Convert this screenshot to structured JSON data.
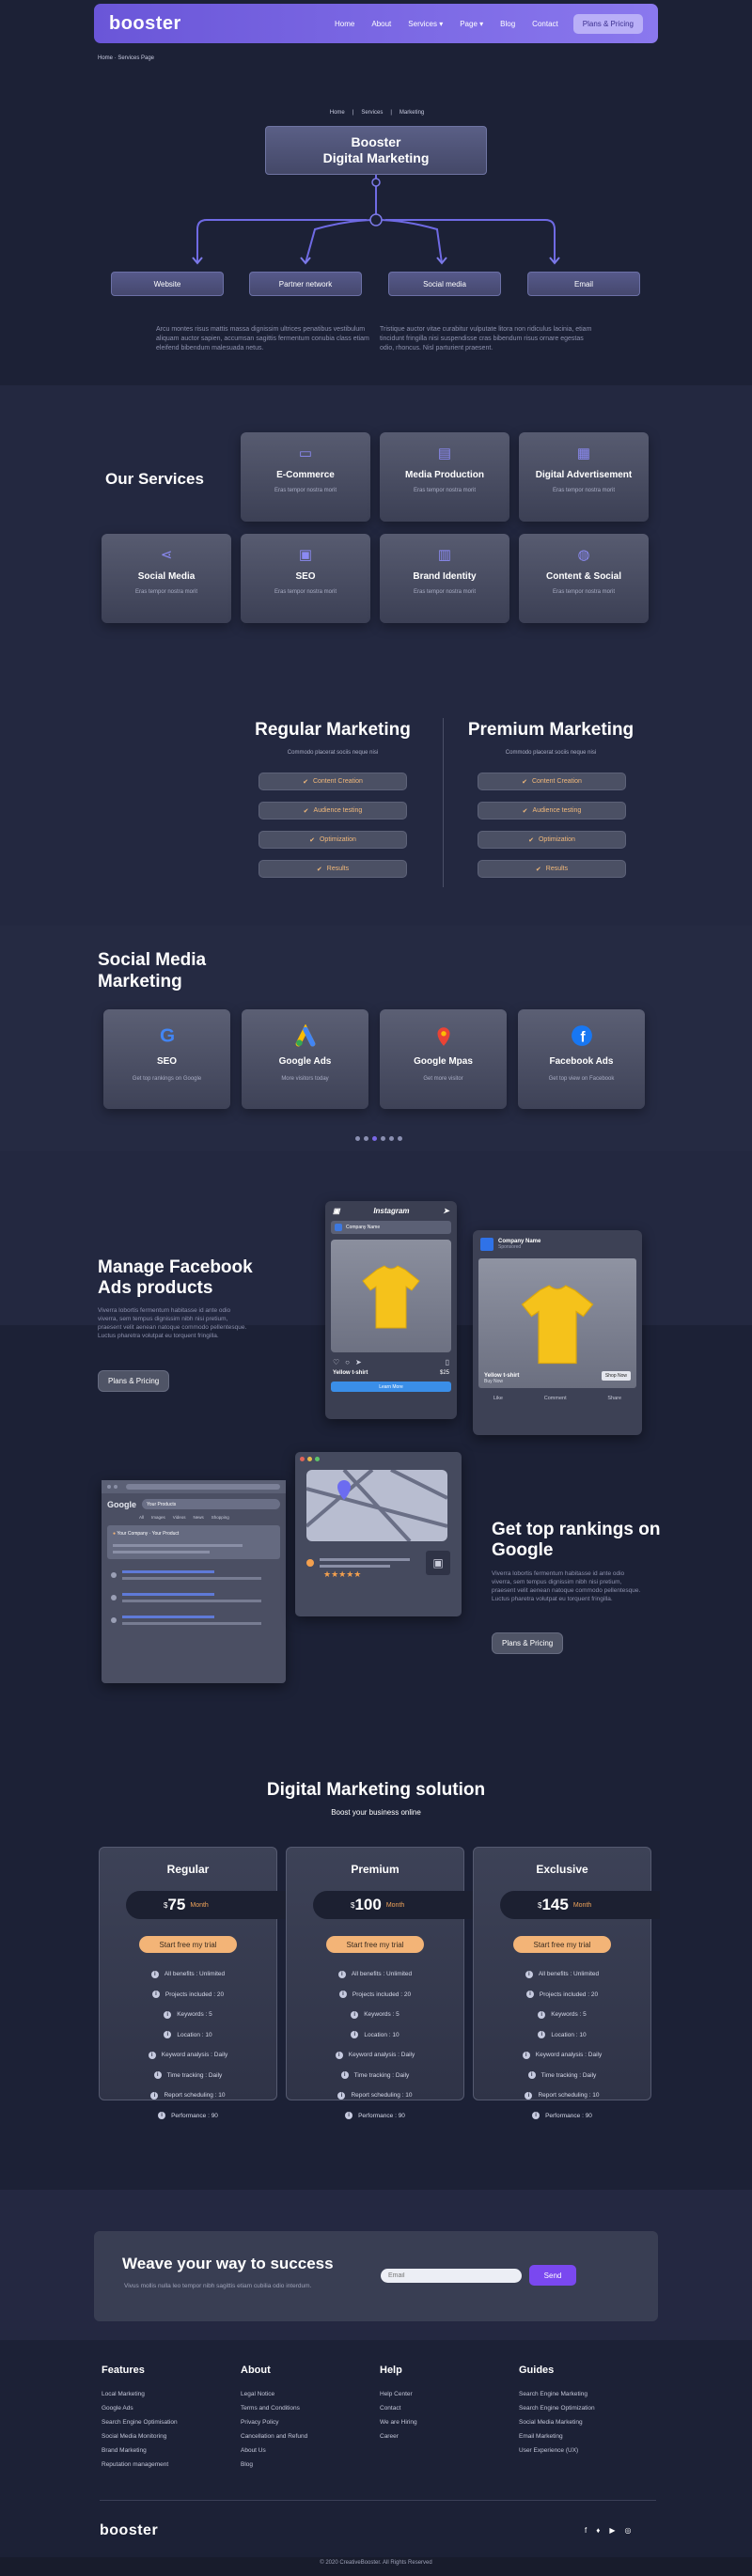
{
  "header": {
    "logo": "booster",
    "menu": [
      "Home",
      "About",
      "Services",
      "Page",
      "Blog",
      "Contact"
    ],
    "cta": "Plans & Pricing"
  },
  "breadcrumb_top": "Home · Services Page",
  "hero": {
    "crumbs": [
      "Home",
      "Services",
      "Marketing"
    ],
    "title_line1": "Booster",
    "title_line2": "Digital Marketing",
    "branches": [
      "Website",
      "Partner network",
      "Social media",
      "Email"
    ],
    "para_left": "Arcu montes risus mattis massa dignissim ultrices penatibus vestibulum aliquam auctor sapien, accumsan sagittis fermentum conubia class etiam eleifend bibendum malesuada netus.",
    "para_right": "Tristique auctor vitae curabitur vulputate litora non ridiculus lacinia, etiam tincidunt fringilla nisi suspendisse cras bibendum risus ornare egestas odio, rhoncus. Nisl parturient praesent."
  },
  "services": {
    "heading": "Our Services",
    "items": [
      {
        "title": "E-Commerce",
        "sub": "Eras tempor nostra morit",
        "icon": "monitor-icon"
      },
      {
        "title": "Media Production",
        "sub": "Eras tempor nostra morit",
        "icon": "media-icon"
      },
      {
        "title": "Digital Advertisement",
        "sub": "Eras tempor nostra morit",
        "icon": "ad-icon"
      },
      {
        "title": "Social Media",
        "sub": "Eras tempor nostra morit",
        "icon": "share-icon"
      },
      {
        "title": "SEO",
        "sub": "Eras tempor nostra morit",
        "icon": "seo-icon"
      },
      {
        "title": "Brand Identity",
        "sub": "Eras tempor nostra morit",
        "icon": "brand-icon"
      },
      {
        "title": "Content & Social",
        "sub": "Eras tempor nostra morit",
        "icon": "bulb-icon"
      }
    ]
  },
  "compare": {
    "regular": {
      "title": "Regular Marketing",
      "sub": "Commodo placerat sociis neque nisi"
    },
    "premium": {
      "title": "Premium Marketing",
      "sub": "Commodo placerat sociis neque nisi"
    },
    "items": [
      "Content Creation",
      "Audience testing",
      "Optimization",
      "Results"
    ]
  },
  "social": {
    "heading_line1": "Social Media",
    "heading_line2": "Marketing",
    "items": [
      {
        "title": "SEO",
        "sub": "Get top rankings on Google"
      },
      {
        "title": "Google Ads",
        "sub": "More visitors today"
      },
      {
        "title": "Google Mpas",
        "sub": "Get more visitor"
      },
      {
        "title": "Facebook Ads",
        "sub": "Get top view on Facebook"
      }
    ]
  },
  "fb": {
    "heading_line1": "Manage Facebook",
    "heading_line2": "Ads products",
    "para": "Viverra lobortis fermentum habitasse id ante odio viverra, sem tempus dignissim nibh nisi pretium, praesent velit aenean natoque commodo pellentesque. Luctus pharetra volutpat eu torquent fringilla.",
    "btn": "Plans & Pricing",
    "insta_brand": "Instagram",
    "insta_user": "Company Name",
    "insta_product": "Yellow t-shirt",
    "insta_price": "$25",
    "insta_cta": "Learn More",
    "fb_company": "Company Name",
    "fb_sponsored": "Sponsored",
    "fb_product": "Yellow t-shirt",
    "fb_sub": "Buy Now",
    "fb_shop": "Shop Now",
    "fb_actions": [
      "Like",
      "Comment",
      "Share"
    ]
  },
  "google": {
    "heading_line1": "Get top rankings on",
    "heading_line2": "Google",
    "para": "Viverra lobortis fermentum habitasse id ante odio viverra, sem tempus dignissim nibh nisi pretium, praesent velit aenean natoque commodo pellentesque. Luctus pharetra volutpat eu torquent fringilla.",
    "btn": "Plans & Pricing",
    "search_text": "Your Products",
    "tabs": [
      "All",
      "Images",
      "Videos",
      "News",
      "Shopping"
    ],
    "result_label": "Your Company",
    "result_sub": "Your Product",
    "stars": "★★★★★"
  },
  "pricing": {
    "heading": "Digital Marketing solution",
    "sub": "Boost your business online",
    "plans": [
      {
        "name": "Regular",
        "price": "75",
        "period": "Month"
      },
      {
        "name": "Premium",
        "price": "100",
        "period": "Month"
      },
      {
        "name": "Exclusive",
        "price": "145",
        "period": "Month"
      }
    ],
    "currency": "$",
    "cta": "Start free my trial",
    "features": [
      "All benefits : Unlimited",
      "Projects included : 20",
      "Keywords : 5",
      "Location : 10",
      "Keyword analysis : Daily",
      "Time tracking : Daily",
      "Report scheduling : 10",
      "Performance : 90"
    ]
  },
  "newsletter": {
    "heading": "Weave your way to success",
    "sub": "Vivus mollis nulla leo tempor nibh sagittis etiam cubilia odio interdum.",
    "placeholder": "Email",
    "btn": "Send"
  },
  "footer": {
    "cols": [
      {
        "title": "Features",
        "links": [
          "Local Marketing",
          "Google Ads",
          "Search Engine Optimisation",
          "Social Media Monitoring",
          "Brand Marketing",
          "Reputation management"
        ]
      },
      {
        "title": "About",
        "links": [
          "Legal Notice",
          "Terms and Conditions",
          "Privacy Policy",
          "Cancellation and Refund",
          "About Us",
          "Blog"
        ]
      },
      {
        "title": "Help",
        "links": [
          "Help Center",
          "Contact",
          "We are Hiring",
          "Career"
        ]
      },
      {
        "title": "Guides",
        "links": [
          "Search Engine Marketing",
          "Search Engine Optimization",
          "Social Media Marketing",
          "Email Marketing",
          "User Experience (UX)"
        ]
      }
    ],
    "logo": "booster",
    "social_icons": [
      "facebook-icon",
      "twitter-icon",
      "youtube-icon",
      "instagram-icon"
    ],
    "copyright": "© 2020 CreativeBooster. All Rights Reserved"
  },
  "colors": {
    "accent": "#7a68e6",
    "orange": "#f3b477",
    "bg": "#1c2136"
  }
}
